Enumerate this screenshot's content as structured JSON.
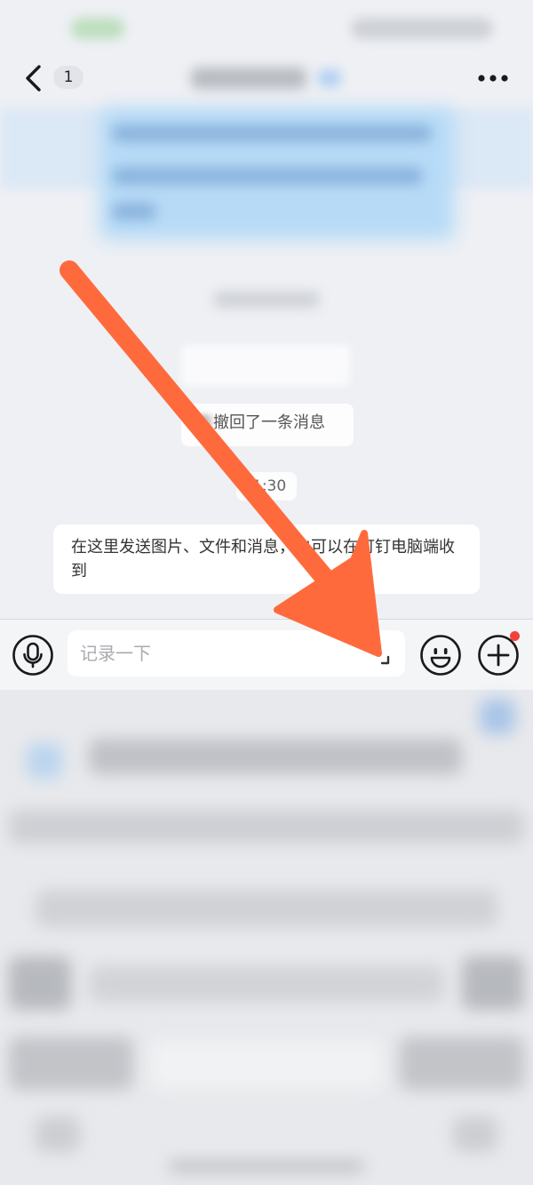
{
  "nav": {
    "unread_count": "1"
  },
  "chat": {
    "recall_notice": "撤回了一条消息",
    "time_label": "1:30",
    "tip_message": "在这里发送图片、文件和消息，也可以在钉钉电脑端收到"
  },
  "input_bar": {
    "placeholder": "记录一下"
  },
  "colors": {
    "arrow": "#ff6a3d",
    "notification_dot": "#f2413b",
    "bubble_blue": "#b7dbf7"
  },
  "icons": {
    "back": "back-chevron-icon",
    "more": "more-dots-icon",
    "voice": "microphone-icon",
    "expand": "expand-icon",
    "emoji": "smiley-icon",
    "add": "plus-circle-icon"
  }
}
